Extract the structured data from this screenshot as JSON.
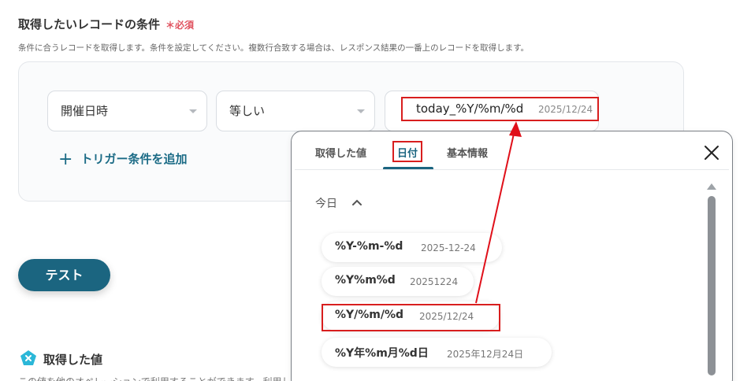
{
  "section": {
    "title": "取得したいレコードの条件",
    "required": "＊必須",
    "description": "条件に合うレコードを取得します。条件を設定してください。複数行合致する場合は、レスポンス結果の一番上のレコードを取得します。"
  },
  "condition": {
    "field": "開催日時",
    "operator": "等しい",
    "value": "today_%Y/%m/%d",
    "value_hint": "2025/12/24",
    "add_trigger_label": "トリガー条件を追加"
  },
  "test_button": "テスト",
  "fetched": {
    "title": "取得した値",
    "description": "この値を他のオペレーションで利用することができます。利用し"
  },
  "popup": {
    "tabs": [
      "取得した値",
      "日付",
      "基本情報"
    ],
    "active_tab": "日付",
    "section_label": "今日",
    "formats": [
      {
        "format": "%Y-%m-%d",
        "example": "2025-12-24"
      },
      {
        "format": "%Y%m%d",
        "example": "20251224"
      },
      {
        "format": "%Y/%m/%d",
        "example": "2025/12/24"
      },
      {
        "format": "%Y年%m月%d日",
        "example": "2025年12月24日"
      }
    ]
  },
  "colors": {
    "accent": "#1b6580",
    "required": "#e0525f",
    "highlight": "#d81e1e"
  },
  "icons": [
    "plus-icon",
    "caret-down-icon",
    "close-icon",
    "chevron-up-icon",
    "yoom-x-icon"
  ]
}
